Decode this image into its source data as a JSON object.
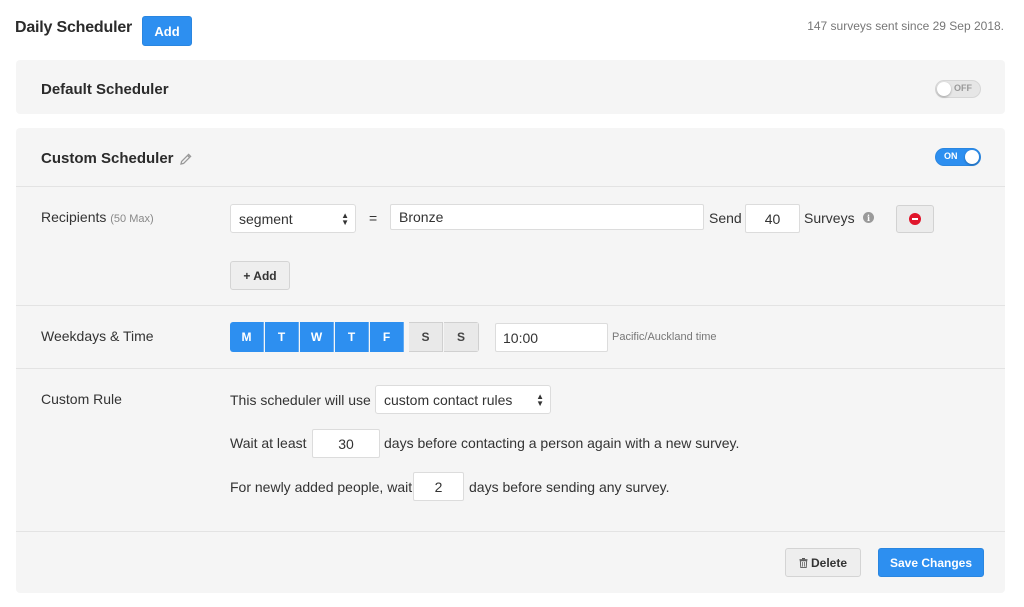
{
  "header": {
    "title": "Daily Scheduler",
    "add_label": "Add",
    "stats": "147 surveys sent since 29 Sep 2018."
  },
  "default_scheduler": {
    "title": "Default Scheduler",
    "toggle_label": "OFF"
  },
  "custom_scheduler": {
    "title": "Custom Scheduler",
    "toggle_label": "ON",
    "recipients": {
      "label": "Recipients",
      "max_note": "(50 Max)",
      "field_select": "segment",
      "operator": "=",
      "value": "Bronze",
      "send_label": "Send",
      "count": "40",
      "surveys_label": "Surveys",
      "add_label": "+ Add"
    },
    "weekdays": {
      "label": "Weekdays & Time",
      "days": [
        {
          "letter": "M",
          "active": true
        },
        {
          "letter": "T",
          "active": true
        },
        {
          "letter": "W",
          "active": true
        },
        {
          "letter": "T",
          "active": true
        },
        {
          "letter": "F",
          "active": true
        },
        {
          "letter": "S",
          "active": false
        },
        {
          "letter": "S",
          "active": false
        }
      ],
      "time": "10:00",
      "timezone": "Pacific/Auckland time"
    },
    "custom_rule": {
      "label": "Custom Rule",
      "use_prefix": "This scheduler will use",
      "use_select": "custom contact rules",
      "wait_prefix": "Wait at least",
      "wait_days": "30",
      "wait_suffix": "days before contacting a person again with a new survey.",
      "new_prefix": "For newly added people, wait",
      "new_days": "2",
      "new_suffix": "days before sending any survey."
    },
    "actions": {
      "delete_label": "Delete",
      "save_label": "Save Changes"
    }
  },
  "colors": {
    "accent": "#2d8ff0",
    "danger": "#e0152b",
    "card_bg": "#f5f5f5"
  }
}
